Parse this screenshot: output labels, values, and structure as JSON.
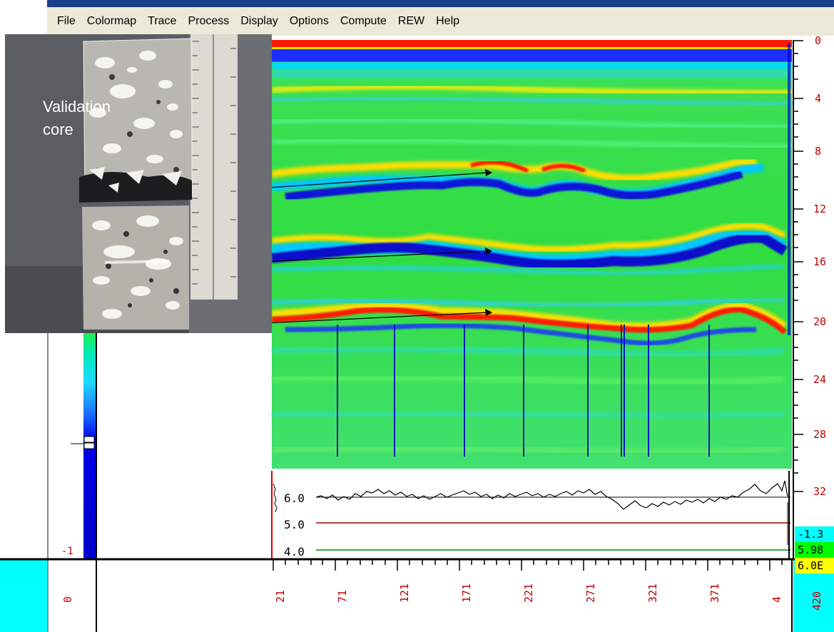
{
  "menu": [
    "File",
    "Colormap",
    "Trace",
    "Process",
    "Display",
    "Options",
    "Compute",
    "REW",
    "Help"
  ],
  "photo": {
    "label_line1": "Validation",
    "label_line2": "core"
  },
  "depth_axis": {
    "labels": [
      "0",
      "4",
      "8",
      "12",
      "16",
      "20",
      "24",
      "28",
      "32"
    ]
  },
  "scan_axis": {
    "labels": [
      "21",
      "71",
      "121",
      "171",
      "221",
      "271",
      "321",
      "371",
      "4"
    ],
    "end_label": "420",
    "start_label": "0"
  },
  "colorbar": {
    "bottom_label": "-1"
  },
  "trace_panel": {
    "levels": [
      "6.0",
      "5.0",
      "4.0"
    ]
  },
  "readouts": [
    "-1.3",
    "5.98",
    "6.0E"
  ],
  "colors": {
    "title": "#1a3d8c",
    "menubar": "#ece9d8",
    "red_band": "#ff1a00",
    "blue": "#0000e0",
    "green": "#33dd33",
    "cyan": "#00d8ff",
    "readout_cyan": "#00ffff",
    "readout_green": "#00ff00",
    "readout_yellow": "#ffff00",
    "axis_red": "#c00000"
  }
}
